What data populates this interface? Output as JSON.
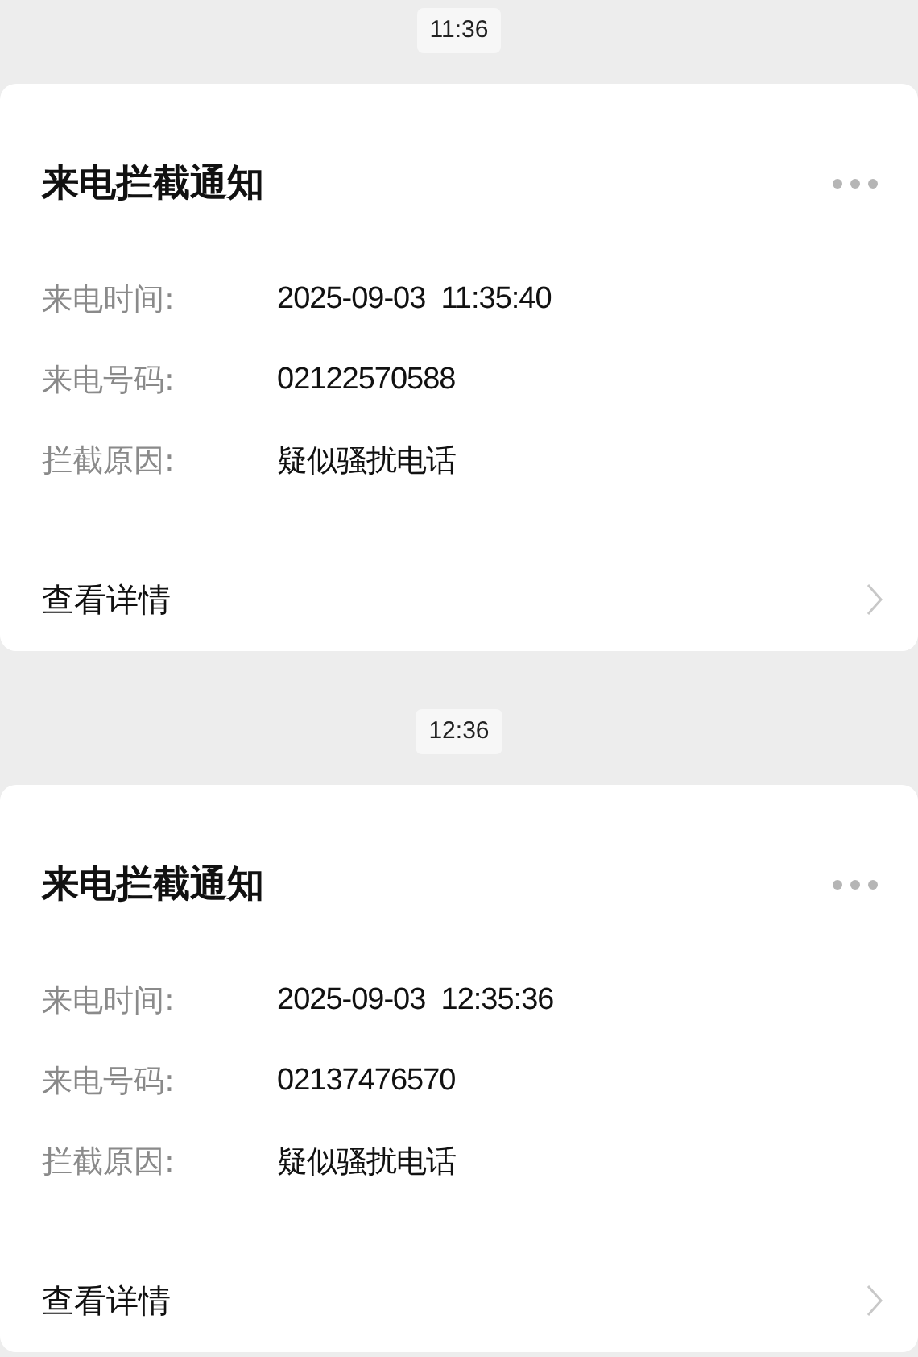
{
  "messages": [
    {
      "time": "11:36",
      "title": "来电拦截通知",
      "fields": [
        {
          "label": "来电时间:",
          "value": "2025-09-03  11:35:40"
        },
        {
          "label": "来电号码:",
          "value": "02122570588"
        },
        {
          "label": "拦截原因:",
          "value": "疑似骚扰电话"
        }
      ],
      "link": "查看详情"
    },
    {
      "time": "12:36",
      "title": "来电拦截通知",
      "fields": [
        {
          "label": "来电时间:",
          "value": "2025-09-03  12:35:36"
        },
        {
          "label": "来电号码:",
          "value": "02137476570"
        },
        {
          "label": "拦截原因:",
          "value": "疑似骚扰电话"
        }
      ],
      "link": "查看详情"
    }
  ]
}
